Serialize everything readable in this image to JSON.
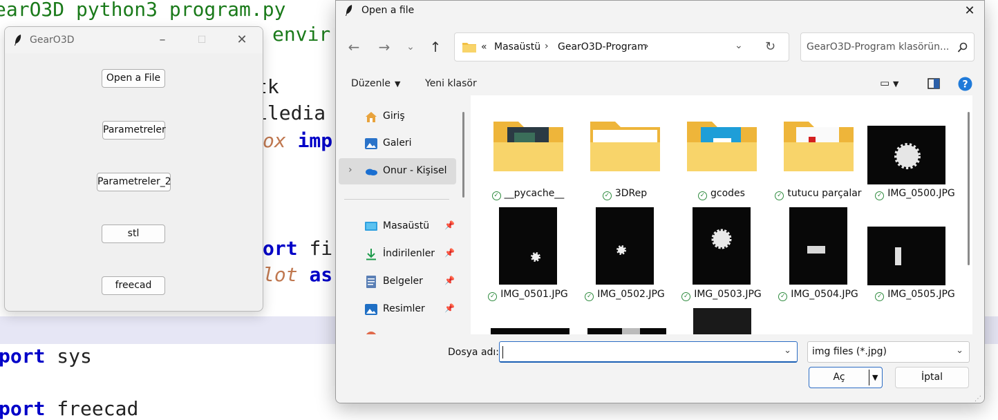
{
  "editor": {
    "lines": [
      {
        "segments": [
          {
            "t": "earO3D python3 program.py",
            "c": "str"
          }
        ]
      },
      {
        "segments": [
          {
            "t": "envir",
            "c": "str"
          }
        ]
      },
      {
        "segments": [
          {
            "t": "tk",
            "c": ""
          }
        ]
      },
      {
        "segments": [
          {
            "t": "iledia",
            "c": ""
          }
        ]
      },
      {
        "segments": [
          {
            "t": "ox ",
            "c": "it"
          },
          {
            "t": "imp",
            "c": "kw"
          }
        ]
      },
      {
        "segments": [
          {
            "t": "ort ",
            "c": "kw"
          },
          {
            "t": "fi",
            "c": ""
          }
        ]
      },
      {
        "segments": [
          {
            "t": "lot ",
            "c": "it"
          },
          {
            "t": "as",
            "c": "kw"
          }
        ]
      },
      {
        "segments": [
          {
            "t": "port ",
            "c": "kw"
          },
          {
            "t": "sys",
            "c": ""
          }
        ]
      },
      {
        "segments": [
          {
            "t": "port ",
            "c": "kw"
          },
          {
            "t": "freecad",
            "c": ""
          }
        ]
      }
    ]
  },
  "tk_window": {
    "title": "GearO3D",
    "buttons": [
      "Open a File",
      "Parametreler",
      "Parametreler_2",
      "stl",
      "freecad"
    ]
  },
  "dialog": {
    "title": "Open a file",
    "breadcrumb": [
      "«",
      "Masaüstü",
      "GearO3D-Program"
    ],
    "search_placeholder": "GearO3D-Program klasörün...",
    "toolbar": {
      "organize": "Düzenle",
      "new_folder": "Yeni klasör"
    },
    "nav": [
      {
        "label": "Giriş",
        "icon": "home-icon"
      },
      {
        "label": "Galeri",
        "icon": "gallery-icon"
      },
      {
        "label": "Onur - Kişisel",
        "icon": "onedrive-icon",
        "selected": true
      },
      {
        "label": "Masaüstü",
        "icon": "desktop-icon",
        "pinned": true
      },
      {
        "label": "İndirilenler",
        "icon": "download-icon",
        "pinned": true
      },
      {
        "label": "Belgeler",
        "icon": "documents-icon",
        "pinned": true
      },
      {
        "label": "Resimler",
        "icon": "pictures-icon",
        "pinned": true
      }
    ],
    "files": [
      {
        "name": "__pycache__",
        "kind": "folder"
      },
      {
        "name": "3DRep",
        "kind": "folder"
      },
      {
        "name": "gcodes",
        "kind": "folder"
      },
      {
        "name": "tutucu parçalar",
        "kind": "folder"
      },
      {
        "name": "IMG_0500.JPG",
        "kind": "image"
      },
      {
        "name": "IMG_0501.JPG",
        "kind": "image"
      },
      {
        "name": "IMG_0502.JPG",
        "kind": "image"
      },
      {
        "name": "IMG_0503.JPG",
        "kind": "image"
      },
      {
        "name": "IMG_0504.JPG",
        "kind": "image"
      },
      {
        "name": "IMG_0505.JPG",
        "kind": "image"
      }
    ],
    "filename_label": "Dosya adı:",
    "filename_value": "",
    "filetype": "img files (*.jpg)",
    "open_label": "Aç",
    "cancel_label": "İptal"
  }
}
